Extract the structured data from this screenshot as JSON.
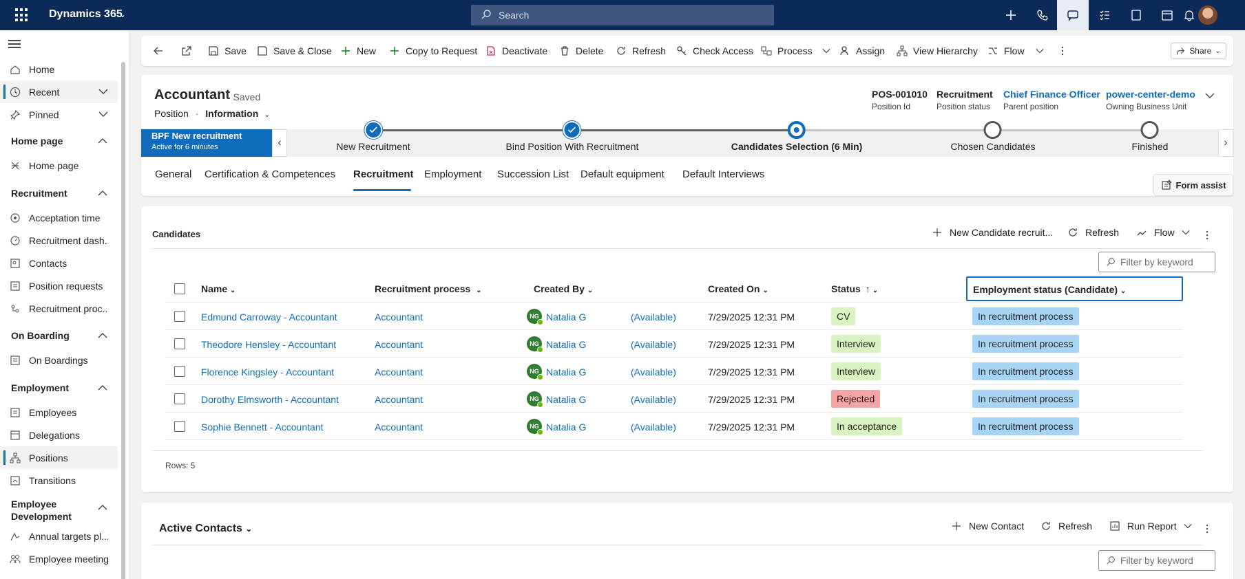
{
  "topbar": {
    "app_name": "Dynamics 365",
    "search_placeholder": "Search"
  },
  "sidebar": {
    "items": [
      {
        "label": "Home"
      },
      {
        "label": "Recent"
      },
      {
        "label": "Pinned"
      },
      {
        "label": "Home page"
      },
      {
        "label": "Acceptation time"
      },
      {
        "label": "Recruitment dash..."
      },
      {
        "label": "Contacts"
      },
      {
        "label": "Position requests"
      },
      {
        "label": "Recruitment proc..."
      },
      {
        "label": "On Boardings"
      },
      {
        "label": "Employees"
      },
      {
        "label": "Delegations"
      },
      {
        "label": "Positions"
      },
      {
        "label": "Transitions"
      },
      {
        "label": "Annual targets pl..."
      },
      {
        "label": "Employee meetings"
      }
    ],
    "groups": {
      "home_page": "Home page",
      "recruitment": "Recruitment",
      "on_boarding": "On Boarding",
      "employment": "Employment",
      "employee_development": "Employee Development"
    }
  },
  "commandbar": {
    "save": "Save",
    "save_close": "Save & Close",
    "new": "New",
    "copy_to_request": "Copy to Request",
    "deactivate": "Deactivate",
    "delete": "Delete",
    "refresh": "Refresh",
    "check_access": "Check Access",
    "process": "Process",
    "assign": "Assign",
    "view_hierarchy": "View Hierarchy",
    "flow": "Flow",
    "share": "Share"
  },
  "record": {
    "title": "Accountant",
    "saved": "- Saved",
    "entity": "Position",
    "sep": "·",
    "form": "Information",
    "fields": [
      {
        "value": "POS-001010",
        "label": "Position Id"
      },
      {
        "value": "Recruitment",
        "label": "Position status"
      },
      {
        "value": "Chief Finance Officer",
        "label": "Parent position"
      },
      {
        "value": "power-center-demo",
        "label": "Owning Business Unit"
      }
    ]
  },
  "bpf": {
    "title": "BPF New recruitment",
    "subtitle": "Active for 6 minutes",
    "stages": [
      {
        "label": "New Recruitment",
        "state": "done"
      },
      {
        "label": "Bind Position With Recruitment",
        "state": "done"
      },
      {
        "label": "Candidates Selection",
        "duration": "(6 Min)",
        "state": "active"
      },
      {
        "label": "Chosen Candidates",
        "state": "todo"
      },
      {
        "label": "Finished",
        "state": "todo"
      }
    ]
  },
  "tabs": [
    "General",
    "Certification & Competences",
    "Recruitment",
    "Employment",
    "Succession List",
    "Default equipment",
    "Default Interviews"
  ],
  "form_assist": "Form assist",
  "candidates": {
    "title": "Candidates",
    "new_btn": "New Candidate recruit...",
    "refresh": "Refresh",
    "flow": "Flow",
    "filter_placeholder": "Filter by keyword",
    "columns": {
      "name": "Name",
      "process": "Recruitment process",
      "created_by": "Created By",
      "created_on": "Created On",
      "status": "Status",
      "emp_status": "Employment status (Candidate)"
    },
    "rows": [
      {
        "name": "Edmund Carroway - Accountant",
        "process": "Accountant",
        "initials": "NG",
        "created_by": "Natalia G",
        "availability": "(Available)",
        "created_on": "7/29/2025 12:31 PM",
        "status": "CV",
        "emp_status": "In recruitment process"
      },
      {
        "name": "Theodore Hensley - Accountant",
        "process": "Accountant",
        "initials": "NG",
        "created_by": "Natalia G",
        "availability": "(Available)",
        "created_on": "7/29/2025 12:31 PM",
        "status": "Interview",
        "emp_status": "In recruitment process"
      },
      {
        "name": "Florence Kingsley - Accountant",
        "process": "Accountant",
        "initials": "NG",
        "created_by": "Natalia G",
        "availability": "(Available)",
        "created_on": "7/29/2025 12:31 PM",
        "status": "Interview",
        "emp_status": "In recruitment process"
      },
      {
        "name": "Dorothy Elmsworth - Accountant",
        "process": "Accountant",
        "initials": "NG",
        "created_by": "Natalia G",
        "availability": "(Available)",
        "created_on": "7/29/2025 12:31 PM",
        "status": "Rejected",
        "emp_status": "In recruitment process"
      },
      {
        "name": "Sophie Bennett - Accountant",
        "process": "Accountant",
        "initials": "NG",
        "created_by": "Natalia G",
        "availability": "(Available)",
        "created_on": "7/29/2025 12:31 PM",
        "status": "In acceptance",
        "emp_status": "In recruitment process"
      }
    ],
    "rows_count": "Rows: 5"
  },
  "contacts": {
    "title": "Active Contacts",
    "new_btn": "New Contact",
    "refresh": "Refresh",
    "run_report": "Run Report",
    "filter_placeholder": "Filter by keyword"
  },
  "colors": {
    "brand": "#0b2a57",
    "accent": "#0f6cbd",
    "status_cv": "#d9f2c2",
    "status_interview": "#d9f2c2",
    "status_rejected": "#f4a6a6",
    "status_acceptance": "#d9f2c2",
    "emp_pill": "#a7d3f5"
  }
}
